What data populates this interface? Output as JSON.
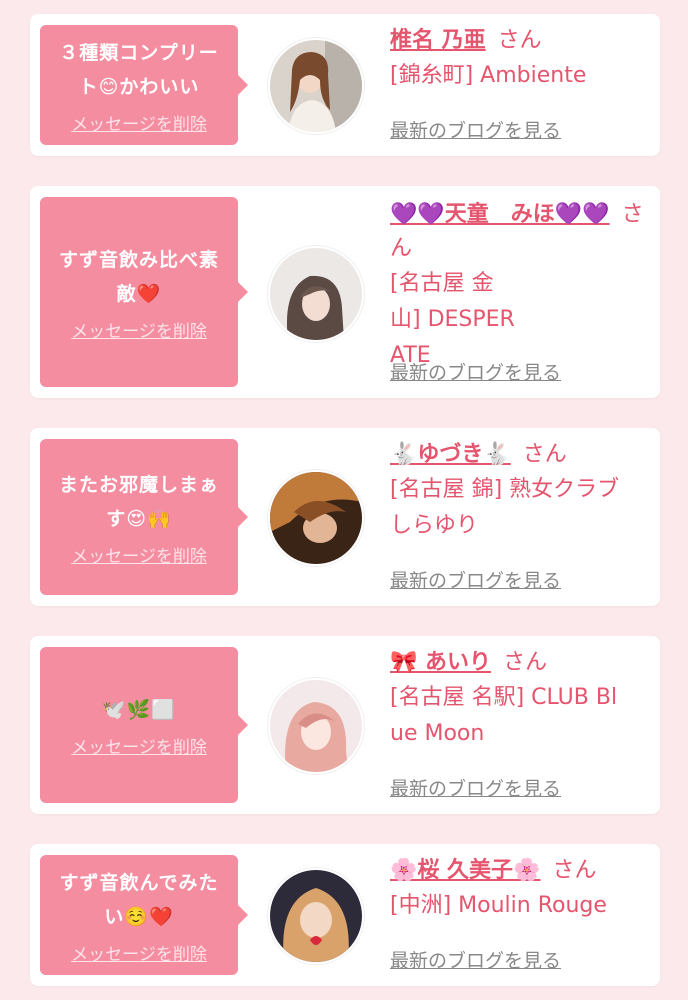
{
  "common": {
    "delete_label": "メッセージを削除",
    "blog_label": "最新のブログを見る",
    "honorific": "さん"
  },
  "items": [
    {
      "message": "３種類コンプリート😊かわいい",
      "name": "椎名 乃亜",
      "shop": "[錦糸町] Ambiente"
    },
    {
      "message": "すず音飲み比べ素敵❤️",
      "name": "💜💜天童　みほ💜💜",
      "shop": "[名古屋 金山] DESPERATE"
    },
    {
      "message": "またお邪魔しまぁす😍🙌",
      "name": "🐇ゆづき🐇",
      "shop": "[名古屋 錦] 熟女クラブ しらゆり"
    },
    {
      "message": "🕊️🌿⬜",
      "name": "🎀 あいり",
      "shop": "[名古屋 名駅] CLUB Blue Moon"
    },
    {
      "message": "すず音飲んでみたい☺️❤️",
      "name": "🌸桜 久美子🌸",
      "shop": "[中洲] Moulin Rouge"
    }
  ],
  "colors": {
    "accent": "#e5556e",
    "bubble": "#f58da1",
    "background": "#fbe9ec"
  }
}
